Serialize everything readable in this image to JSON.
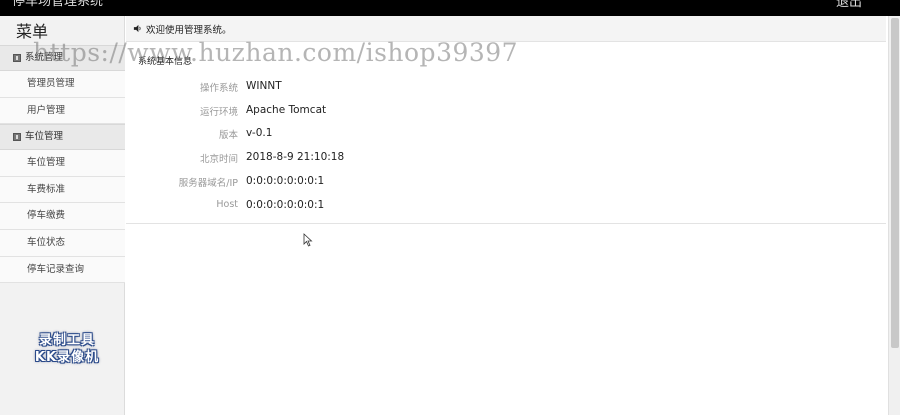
{
  "topbar": {
    "title": "停车场管理系统",
    "logout_label": "退出"
  },
  "sidebar": {
    "menu_title": "菜单",
    "groups": [
      {
        "label": "系统管理",
        "items": [
          "管理员管理",
          "用户管理"
        ]
      },
      {
        "label": "车位管理",
        "items": [
          "车位管理",
          "车费标准",
          "停车缴费",
          "车位状态",
          "停车记录查询"
        ]
      }
    ]
  },
  "watermark_logo": {
    "line1": "录制工具",
    "line2": "KK录像机"
  },
  "url_watermark": "https://www.huzhan.com/ishop39397",
  "notice": {
    "text": "欢迎使用管理系统。"
  },
  "panel": {
    "title": "系统基本信息",
    "rows": [
      {
        "label": "操作系统",
        "value": "WINNT"
      },
      {
        "label": "运行环境",
        "value": "Apache Tomcat"
      },
      {
        "label": "版本",
        "value": "v-0.1"
      },
      {
        "label": "北京时间",
        "value": "2018-8-9 21:10:18"
      },
      {
        "label": "服务器域名/IP",
        "value": "0:0:0:0:0:0:0:1"
      },
      {
        "label": "Host",
        "value": "0:0:0:0:0:0:0:1"
      }
    ]
  },
  "icons": {
    "group": "book-icon",
    "notice": "speaker-icon",
    "cursor": "mouse-pointer-icon"
  }
}
